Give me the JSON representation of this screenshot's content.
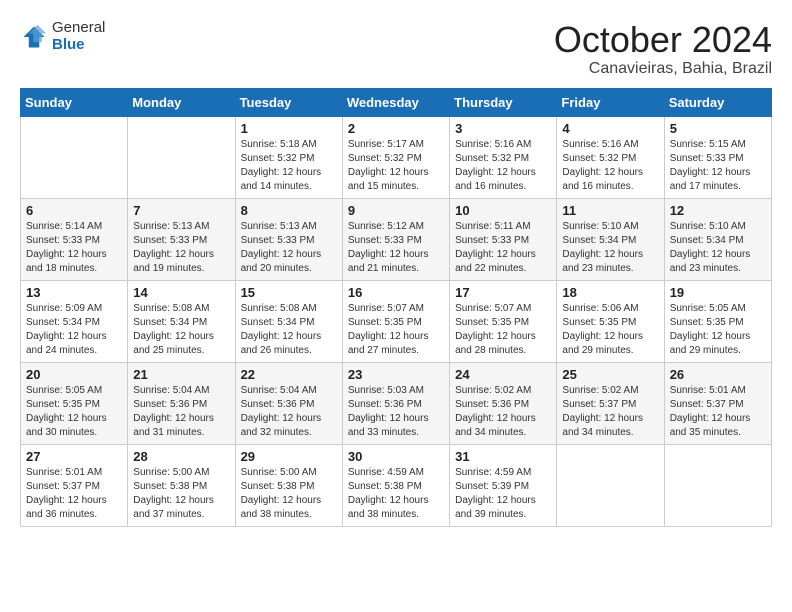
{
  "header": {
    "logo_general": "General",
    "logo_blue": "Blue",
    "month_title": "October 2024",
    "location": "Canavieiras, Bahia, Brazil"
  },
  "weekdays": [
    "Sunday",
    "Monday",
    "Tuesday",
    "Wednesday",
    "Thursday",
    "Friday",
    "Saturday"
  ],
  "weeks": [
    [
      {
        "day": "",
        "info": ""
      },
      {
        "day": "",
        "info": ""
      },
      {
        "day": "1",
        "info": "Sunrise: 5:18 AM\nSunset: 5:32 PM\nDaylight: 12 hours and 14 minutes."
      },
      {
        "day": "2",
        "info": "Sunrise: 5:17 AM\nSunset: 5:32 PM\nDaylight: 12 hours and 15 minutes."
      },
      {
        "day": "3",
        "info": "Sunrise: 5:16 AM\nSunset: 5:32 PM\nDaylight: 12 hours and 16 minutes."
      },
      {
        "day": "4",
        "info": "Sunrise: 5:16 AM\nSunset: 5:32 PM\nDaylight: 12 hours and 16 minutes."
      },
      {
        "day": "5",
        "info": "Sunrise: 5:15 AM\nSunset: 5:33 PM\nDaylight: 12 hours and 17 minutes."
      }
    ],
    [
      {
        "day": "6",
        "info": "Sunrise: 5:14 AM\nSunset: 5:33 PM\nDaylight: 12 hours and 18 minutes."
      },
      {
        "day": "7",
        "info": "Sunrise: 5:13 AM\nSunset: 5:33 PM\nDaylight: 12 hours and 19 minutes."
      },
      {
        "day": "8",
        "info": "Sunrise: 5:13 AM\nSunset: 5:33 PM\nDaylight: 12 hours and 20 minutes."
      },
      {
        "day": "9",
        "info": "Sunrise: 5:12 AM\nSunset: 5:33 PM\nDaylight: 12 hours and 21 minutes."
      },
      {
        "day": "10",
        "info": "Sunrise: 5:11 AM\nSunset: 5:33 PM\nDaylight: 12 hours and 22 minutes."
      },
      {
        "day": "11",
        "info": "Sunrise: 5:10 AM\nSunset: 5:34 PM\nDaylight: 12 hours and 23 minutes."
      },
      {
        "day": "12",
        "info": "Sunrise: 5:10 AM\nSunset: 5:34 PM\nDaylight: 12 hours and 23 minutes."
      }
    ],
    [
      {
        "day": "13",
        "info": "Sunrise: 5:09 AM\nSunset: 5:34 PM\nDaylight: 12 hours and 24 minutes."
      },
      {
        "day": "14",
        "info": "Sunrise: 5:08 AM\nSunset: 5:34 PM\nDaylight: 12 hours and 25 minutes."
      },
      {
        "day": "15",
        "info": "Sunrise: 5:08 AM\nSunset: 5:34 PM\nDaylight: 12 hours and 26 minutes."
      },
      {
        "day": "16",
        "info": "Sunrise: 5:07 AM\nSunset: 5:35 PM\nDaylight: 12 hours and 27 minutes."
      },
      {
        "day": "17",
        "info": "Sunrise: 5:07 AM\nSunset: 5:35 PM\nDaylight: 12 hours and 28 minutes."
      },
      {
        "day": "18",
        "info": "Sunrise: 5:06 AM\nSunset: 5:35 PM\nDaylight: 12 hours and 29 minutes."
      },
      {
        "day": "19",
        "info": "Sunrise: 5:05 AM\nSunset: 5:35 PM\nDaylight: 12 hours and 29 minutes."
      }
    ],
    [
      {
        "day": "20",
        "info": "Sunrise: 5:05 AM\nSunset: 5:35 PM\nDaylight: 12 hours and 30 minutes."
      },
      {
        "day": "21",
        "info": "Sunrise: 5:04 AM\nSunset: 5:36 PM\nDaylight: 12 hours and 31 minutes."
      },
      {
        "day": "22",
        "info": "Sunrise: 5:04 AM\nSunset: 5:36 PM\nDaylight: 12 hours and 32 minutes."
      },
      {
        "day": "23",
        "info": "Sunrise: 5:03 AM\nSunset: 5:36 PM\nDaylight: 12 hours and 33 minutes."
      },
      {
        "day": "24",
        "info": "Sunrise: 5:02 AM\nSunset: 5:36 PM\nDaylight: 12 hours and 34 minutes."
      },
      {
        "day": "25",
        "info": "Sunrise: 5:02 AM\nSunset: 5:37 PM\nDaylight: 12 hours and 34 minutes."
      },
      {
        "day": "26",
        "info": "Sunrise: 5:01 AM\nSunset: 5:37 PM\nDaylight: 12 hours and 35 minutes."
      }
    ],
    [
      {
        "day": "27",
        "info": "Sunrise: 5:01 AM\nSunset: 5:37 PM\nDaylight: 12 hours and 36 minutes."
      },
      {
        "day": "28",
        "info": "Sunrise: 5:00 AM\nSunset: 5:38 PM\nDaylight: 12 hours and 37 minutes."
      },
      {
        "day": "29",
        "info": "Sunrise: 5:00 AM\nSunset: 5:38 PM\nDaylight: 12 hours and 38 minutes."
      },
      {
        "day": "30",
        "info": "Sunrise: 4:59 AM\nSunset: 5:38 PM\nDaylight: 12 hours and 38 minutes."
      },
      {
        "day": "31",
        "info": "Sunrise: 4:59 AM\nSunset: 5:39 PM\nDaylight: 12 hours and 39 minutes."
      },
      {
        "day": "",
        "info": ""
      },
      {
        "day": "",
        "info": ""
      }
    ]
  ]
}
